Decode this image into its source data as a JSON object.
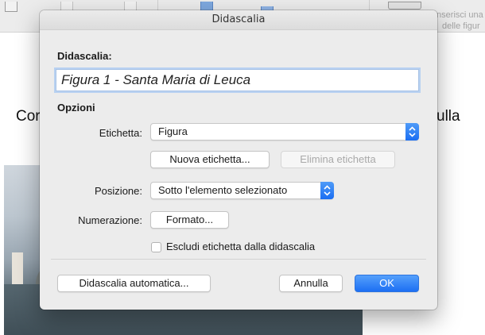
{
  "background": {
    "hint_lines": [
      "Inserisci una",
      "delle figur"
    ],
    "text_left": "Cor",
    "text_right": "ulla"
  },
  "dialog": {
    "title": "Didascalia",
    "caption_label": "Didascalia:",
    "caption_value": "Figura 1 - Santa Maria di Leuca",
    "options_label": "Opzioni",
    "label_label": "Etichetta:",
    "label_value": "Figura",
    "new_label_button": "Nuova etichetta...",
    "delete_label_button": "Elimina etichetta",
    "position_label": "Posizione:",
    "position_value": "Sotto l'elemento selezionato",
    "numbering_label": "Numerazione:",
    "format_button": "Formato...",
    "exclude_checkbox_label": "Escludi etichetta dalla didascalia",
    "exclude_checked": false,
    "autocaption_button": "Didascalia automatica...",
    "cancel_button": "Annulla",
    "ok_button": "OK"
  },
  "colors": {
    "accent": "#1d6ff3",
    "focus_ring": "#b8d1f1"
  }
}
